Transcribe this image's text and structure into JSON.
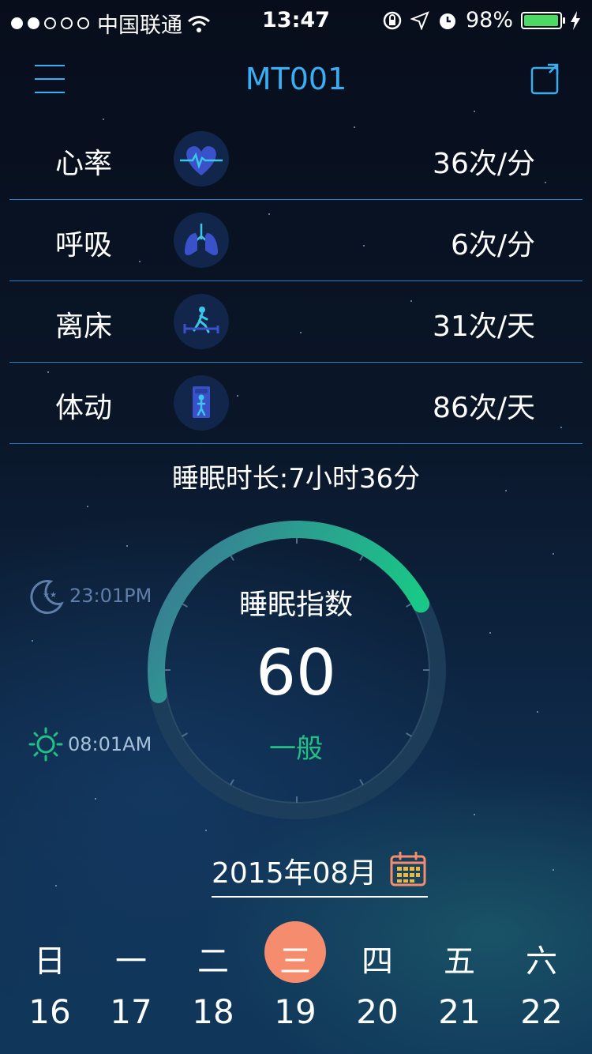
{
  "status_bar": {
    "carrier": "中国联通",
    "time": "13:47",
    "battery_percent": "98%",
    "battery_level": 0.98,
    "signal_dots_filled": 2,
    "signal_dots_total": 5
  },
  "header": {
    "title": "MT001",
    "menu_icon": "hamburger-icon",
    "share_icon": "share-icon"
  },
  "metrics": [
    {
      "label": "心率",
      "value": "36次/分",
      "icon": "heart-rate-icon"
    },
    {
      "label": "呼吸",
      "value": "6次/分",
      "icon": "lungs-icon"
    },
    {
      "label": "离床",
      "value": "31次/天",
      "icon": "leave-bed-icon"
    },
    {
      "label": "体动",
      "value": "86次/天",
      "icon": "body-move-icon"
    }
  ],
  "sleep": {
    "duration": "睡眠时长:7小时36分",
    "bedtime": "23:01PM",
    "waketime": "08:01AM",
    "index_title": "睡眠指数",
    "index_score": "60",
    "index_value": 60,
    "index_level": "一般"
  },
  "calendar": {
    "month": "2015年08月",
    "days": [
      {
        "weekday": "日",
        "date": "16",
        "selected": false
      },
      {
        "weekday": "一",
        "date": "17",
        "selected": false
      },
      {
        "weekday": "二",
        "date": "18",
        "selected": false
      },
      {
        "weekday": "三",
        "date": "19",
        "selected": true
      },
      {
        "weekday": "四",
        "date": "20",
        "selected": false
      },
      {
        "weekday": "五",
        "date": "21",
        "selected": false
      },
      {
        "weekday": "六",
        "date": "22",
        "selected": false
      }
    ]
  },
  "colors": {
    "accent": "#3aaef2",
    "good": "#21c185",
    "selected_day": "#f58c6d",
    "battery": "#4cd964"
  }
}
